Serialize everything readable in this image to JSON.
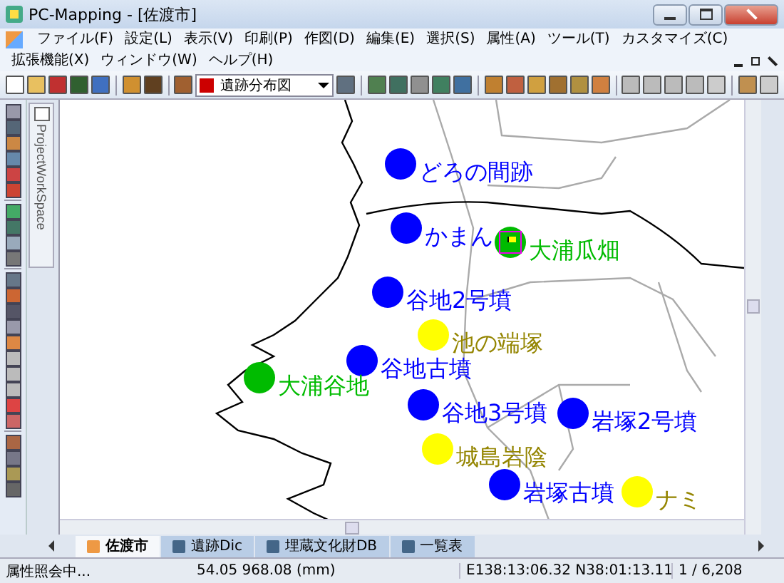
{
  "window": {
    "title": "PC-Mapping - [佐渡市]"
  },
  "menu": [
    "ファイル(F)",
    "設定(L)",
    "表示(V)",
    "印刷(P)",
    "作図(D)",
    "編集(E)",
    "選択(S)",
    "属性(A)",
    "ツール(T)",
    "カスタマイズ(C)",
    "拡張機能(X)",
    "ウィンドウ(W)",
    "ヘルプ(H)"
  ],
  "toolbar": {
    "layer_select": {
      "value": "遺跡分布図"
    }
  },
  "workspace_tab": {
    "label": "ProjectWorkSpace"
  },
  "map": {
    "sites": [
      {
        "label": "どろの間跡",
        "color": "#0000ff"
      },
      {
        "label": "かまん",
        "color": "#0000ff"
      },
      {
        "label": "大浦瓜畑",
        "color": "#00bb00"
      },
      {
        "label": "谷地2号墳",
        "color": "#0000ff"
      },
      {
        "label": "池の端塚",
        "color": "#ffff00"
      },
      {
        "label": "谷地古墳",
        "color": "#0000ff"
      },
      {
        "label": "大浦谷地",
        "color": "#00bb00"
      },
      {
        "label": "谷地3号墳",
        "color": "#0000ff"
      },
      {
        "label": "岩塚2号墳",
        "color": "#0000ff"
      },
      {
        "label": "城島岩陰",
        "color": "#ffff00"
      },
      {
        "label": "岩塚古墳",
        "color": "#0000ff"
      },
      {
        "label": "ナミ",
        "color": "#ffff00"
      }
    ]
  },
  "sheet_tabs": [
    {
      "label": "佐渡市",
      "selected": true
    },
    {
      "label": "遺跡Dic",
      "selected": false
    },
    {
      "label": "埋蔵文化財DB",
      "selected": false
    },
    {
      "label": "一覧表",
      "selected": false
    }
  ],
  "status_bar": {
    "message": "属性照会中...",
    "distance": "54.05 968.08 (mm)",
    "coordinates": "E138:13:06.32 N38:01:13.11",
    "record": "1 / 6,208"
  }
}
